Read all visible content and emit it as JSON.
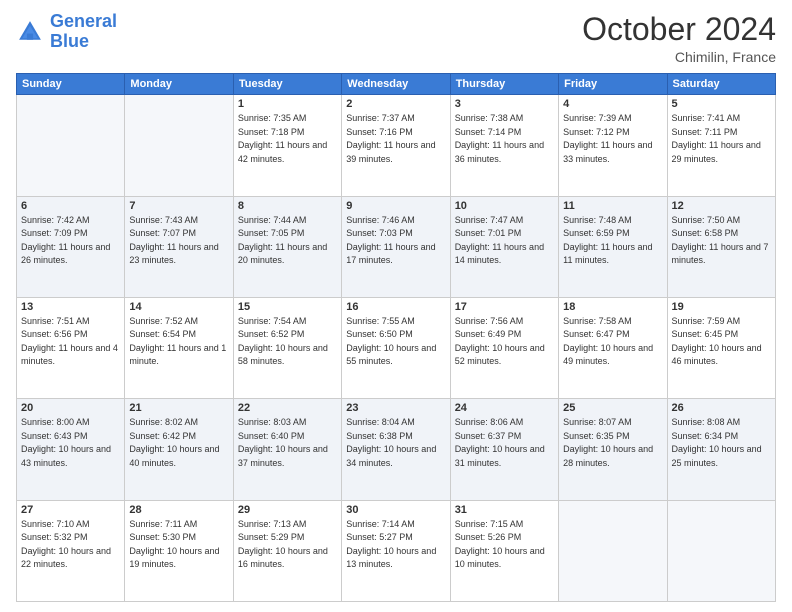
{
  "logo": {
    "line1": "General",
    "line2": "Blue"
  },
  "header": {
    "month": "October 2024",
    "location": "Chimilin, France"
  },
  "weekdays": [
    "Sunday",
    "Monday",
    "Tuesday",
    "Wednesday",
    "Thursday",
    "Friday",
    "Saturday"
  ],
  "weeks": [
    [
      {
        "day": "",
        "sunrise": "",
        "sunset": "",
        "daylight": ""
      },
      {
        "day": "",
        "sunrise": "",
        "sunset": "",
        "daylight": ""
      },
      {
        "day": "1",
        "sunrise": "Sunrise: 7:35 AM",
        "sunset": "Sunset: 7:18 PM",
        "daylight": "Daylight: 11 hours and 42 minutes."
      },
      {
        "day": "2",
        "sunrise": "Sunrise: 7:37 AM",
        "sunset": "Sunset: 7:16 PM",
        "daylight": "Daylight: 11 hours and 39 minutes."
      },
      {
        "day": "3",
        "sunrise": "Sunrise: 7:38 AM",
        "sunset": "Sunset: 7:14 PM",
        "daylight": "Daylight: 11 hours and 36 minutes."
      },
      {
        "day": "4",
        "sunrise": "Sunrise: 7:39 AM",
        "sunset": "Sunset: 7:12 PM",
        "daylight": "Daylight: 11 hours and 33 minutes."
      },
      {
        "day": "5",
        "sunrise": "Sunrise: 7:41 AM",
        "sunset": "Sunset: 7:11 PM",
        "daylight": "Daylight: 11 hours and 29 minutes."
      }
    ],
    [
      {
        "day": "6",
        "sunrise": "Sunrise: 7:42 AM",
        "sunset": "Sunset: 7:09 PM",
        "daylight": "Daylight: 11 hours and 26 minutes."
      },
      {
        "day": "7",
        "sunrise": "Sunrise: 7:43 AM",
        "sunset": "Sunset: 7:07 PM",
        "daylight": "Daylight: 11 hours and 23 minutes."
      },
      {
        "day": "8",
        "sunrise": "Sunrise: 7:44 AM",
        "sunset": "Sunset: 7:05 PM",
        "daylight": "Daylight: 11 hours and 20 minutes."
      },
      {
        "day": "9",
        "sunrise": "Sunrise: 7:46 AM",
        "sunset": "Sunset: 7:03 PM",
        "daylight": "Daylight: 11 hours and 17 minutes."
      },
      {
        "day": "10",
        "sunrise": "Sunrise: 7:47 AM",
        "sunset": "Sunset: 7:01 PM",
        "daylight": "Daylight: 11 hours and 14 minutes."
      },
      {
        "day": "11",
        "sunrise": "Sunrise: 7:48 AM",
        "sunset": "Sunset: 6:59 PM",
        "daylight": "Daylight: 11 hours and 11 minutes."
      },
      {
        "day": "12",
        "sunrise": "Sunrise: 7:50 AM",
        "sunset": "Sunset: 6:58 PM",
        "daylight": "Daylight: 11 hours and 7 minutes."
      }
    ],
    [
      {
        "day": "13",
        "sunrise": "Sunrise: 7:51 AM",
        "sunset": "Sunset: 6:56 PM",
        "daylight": "Daylight: 11 hours and 4 minutes."
      },
      {
        "day": "14",
        "sunrise": "Sunrise: 7:52 AM",
        "sunset": "Sunset: 6:54 PM",
        "daylight": "Daylight: 11 hours and 1 minute."
      },
      {
        "day": "15",
        "sunrise": "Sunrise: 7:54 AM",
        "sunset": "Sunset: 6:52 PM",
        "daylight": "Daylight: 10 hours and 58 minutes."
      },
      {
        "day": "16",
        "sunrise": "Sunrise: 7:55 AM",
        "sunset": "Sunset: 6:50 PM",
        "daylight": "Daylight: 10 hours and 55 minutes."
      },
      {
        "day": "17",
        "sunrise": "Sunrise: 7:56 AM",
        "sunset": "Sunset: 6:49 PM",
        "daylight": "Daylight: 10 hours and 52 minutes."
      },
      {
        "day": "18",
        "sunrise": "Sunrise: 7:58 AM",
        "sunset": "Sunset: 6:47 PM",
        "daylight": "Daylight: 10 hours and 49 minutes."
      },
      {
        "day": "19",
        "sunrise": "Sunrise: 7:59 AM",
        "sunset": "Sunset: 6:45 PM",
        "daylight": "Daylight: 10 hours and 46 minutes."
      }
    ],
    [
      {
        "day": "20",
        "sunrise": "Sunrise: 8:00 AM",
        "sunset": "Sunset: 6:43 PM",
        "daylight": "Daylight: 10 hours and 43 minutes."
      },
      {
        "day": "21",
        "sunrise": "Sunrise: 8:02 AM",
        "sunset": "Sunset: 6:42 PM",
        "daylight": "Daylight: 10 hours and 40 minutes."
      },
      {
        "day": "22",
        "sunrise": "Sunrise: 8:03 AM",
        "sunset": "Sunset: 6:40 PM",
        "daylight": "Daylight: 10 hours and 37 minutes."
      },
      {
        "day": "23",
        "sunrise": "Sunrise: 8:04 AM",
        "sunset": "Sunset: 6:38 PM",
        "daylight": "Daylight: 10 hours and 34 minutes."
      },
      {
        "day": "24",
        "sunrise": "Sunrise: 8:06 AM",
        "sunset": "Sunset: 6:37 PM",
        "daylight": "Daylight: 10 hours and 31 minutes."
      },
      {
        "day": "25",
        "sunrise": "Sunrise: 8:07 AM",
        "sunset": "Sunset: 6:35 PM",
        "daylight": "Daylight: 10 hours and 28 minutes."
      },
      {
        "day": "26",
        "sunrise": "Sunrise: 8:08 AM",
        "sunset": "Sunset: 6:34 PM",
        "daylight": "Daylight: 10 hours and 25 minutes."
      }
    ],
    [
      {
        "day": "27",
        "sunrise": "Sunrise: 7:10 AM",
        "sunset": "Sunset: 5:32 PM",
        "daylight": "Daylight: 10 hours and 22 minutes."
      },
      {
        "day": "28",
        "sunrise": "Sunrise: 7:11 AM",
        "sunset": "Sunset: 5:30 PM",
        "daylight": "Daylight: 10 hours and 19 minutes."
      },
      {
        "day": "29",
        "sunrise": "Sunrise: 7:13 AM",
        "sunset": "Sunset: 5:29 PM",
        "daylight": "Daylight: 10 hours and 16 minutes."
      },
      {
        "day": "30",
        "sunrise": "Sunrise: 7:14 AM",
        "sunset": "Sunset: 5:27 PM",
        "daylight": "Daylight: 10 hours and 13 minutes."
      },
      {
        "day": "31",
        "sunrise": "Sunrise: 7:15 AM",
        "sunset": "Sunset: 5:26 PM",
        "daylight": "Daylight: 10 hours and 10 minutes."
      },
      {
        "day": "",
        "sunrise": "",
        "sunset": "",
        "daylight": ""
      },
      {
        "day": "",
        "sunrise": "",
        "sunset": "",
        "daylight": ""
      }
    ]
  ]
}
